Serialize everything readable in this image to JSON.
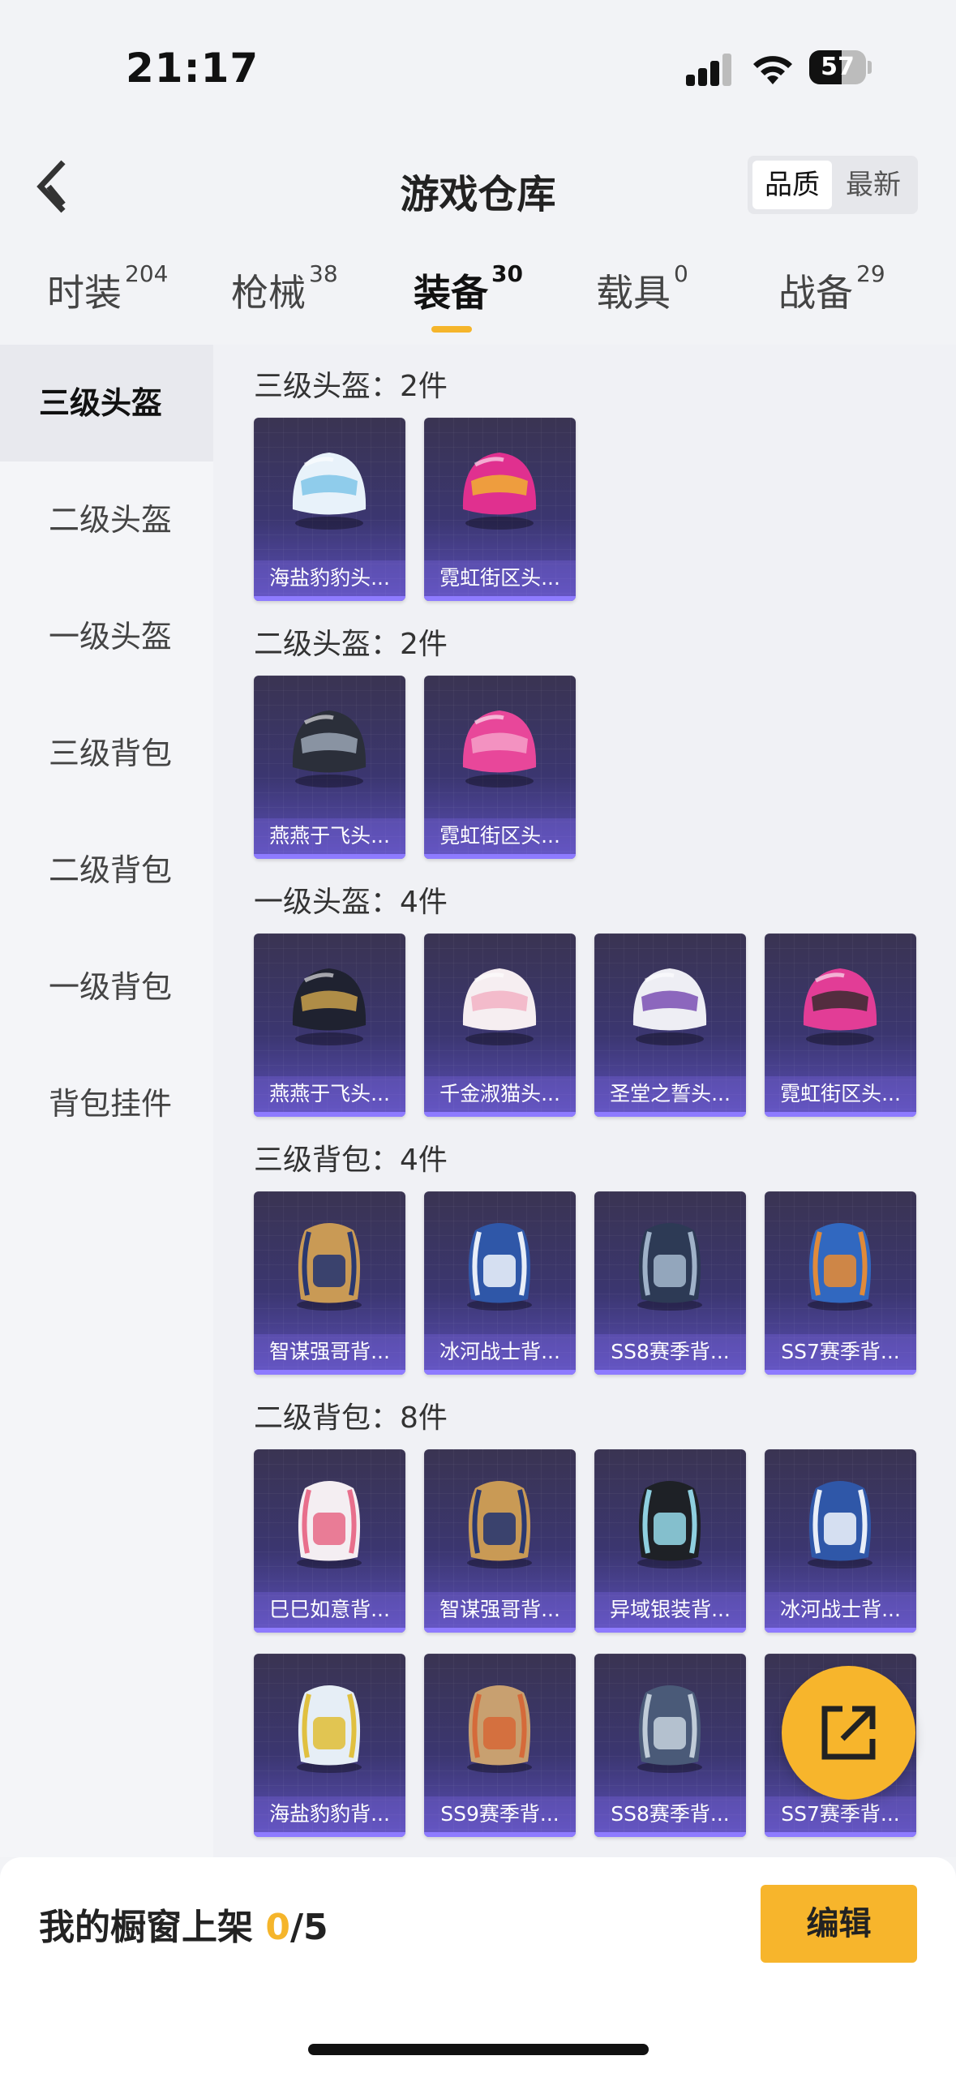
{
  "status": {
    "time": "21:17",
    "battery": "57",
    "battery_level": 0.57
  },
  "header": {
    "title": "游戏仓库",
    "sort_options": [
      "品质",
      "最新"
    ]
  },
  "tabs": [
    {
      "label": "时装",
      "count": "204"
    },
    {
      "label": "枪械",
      "count": "38"
    },
    {
      "label": "装备",
      "count": "30",
      "active": true
    },
    {
      "label": "载具",
      "count": "0"
    },
    {
      "label": "战备",
      "count": "29"
    }
  ],
  "sidebar": [
    "三级头盔",
    "二级头盔",
    "一级头盔",
    "三级背包",
    "二级背包",
    "一级背包",
    "背包挂件"
  ],
  "sections": [
    {
      "title": "三级头盔：2件",
      "items": [
        {
          "name": "海盐豹豹头...",
          "icon": "helmet-white-blue"
        },
        {
          "name": "霓虹街区头...",
          "icon": "helmet-pink-visor"
        }
      ]
    },
    {
      "title": "二级头盔：2件",
      "items": [
        {
          "name": "燕燕于飞头...",
          "icon": "helmet-dark-swirl"
        },
        {
          "name": "霓虹街区头...",
          "icon": "helmet-pink"
        }
      ]
    },
    {
      "title": "一级头盔：4件",
      "items": [
        {
          "name": "燕燕于飞头...",
          "icon": "helmet-dark-gold"
        },
        {
          "name": "千金淑猫头...",
          "icon": "helmet-white-pink-cat"
        },
        {
          "name": "圣堂之誓头...",
          "icon": "helmet-white-purple"
        },
        {
          "name": "霓虹街区头...",
          "icon": "helmet-pink-glitter"
        }
      ]
    },
    {
      "title": "三级背包：4件",
      "items": [
        {
          "name": "智谋强哥背...",
          "icon": "backpack-bear-gold"
        },
        {
          "name": "冰河战士背...",
          "icon": "backpack-blue-white"
        },
        {
          "name": "SS8赛季背...",
          "icon": "backpack-navy"
        },
        {
          "name": "SS7赛季背...",
          "icon": "backpack-blue-orange"
        }
      ]
    },
    {
      "title": "二级背包：8件",
      "items": [
        {
          "name": "巳巳如意背...",
          "icon": "backpack-white-bunny"
        },
        {
          "name": "智谋强哥背...",
          "icon": "backpack-bear-gold"
        },
        {
          "name": "异域银装背...",
          "icon": "backpack-black-harness"
        },
        {
          "name": "冰河战士背...",
          "icon": "backpack-blue-white"
        },
        {
          "name": "海盐豹豹背...",
          "icon": "backpack-seal-white"
        },
        {
          "name": "SS9赛季背...",
          "icon": "backpack-tan-plaid"
        },
        {
          "name": "SS8赛季背...",
          "icon": "backpack-slate"
        },
        {
          "name": "SS7赛季背...",
          "icon": "backpack-blue"
        }
      ]
    }
  ],
  "bottom": {
    "label": "我的橱窗上架 ",
    "current": "0",
    "total": "/5",
    "edit": "编辑"
  }
}
